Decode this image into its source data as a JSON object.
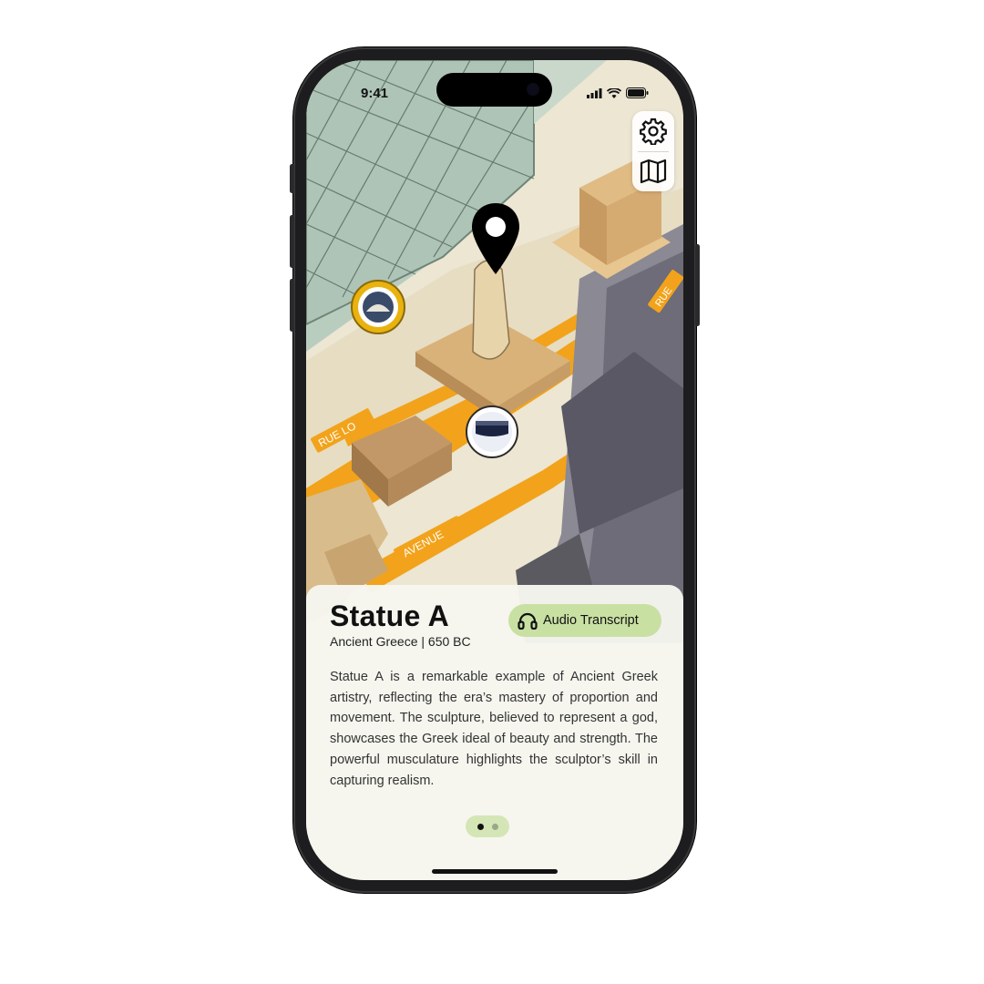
{
  "status_bar": {
    "time": "9:41"
  },
  "map_controls": {
    "settings_icon": "gear-icon",
    "map_icon": "map-icon"
  },
  "map_labels": [
    "RUE LO",
    "AVENUE",
    "RUE"
  ],
  "exhibit": {
    "title": "Statue A",
    "subtitle": "Ancient Greece | 650 BC",
    "audio_button_label": "Audio Transcript",
    "audio_icon": "headphones-icon",
    "description": "Statue A is a remarkable example of Ancient Greek artistry, reflecting the era’s mastery of proportion and movement. The sculpture, believed to represent a god, showcases the Greek ideal of beauty and strength. The powerful musculature highlights the sculptor’s skill in capturing realism."
  },
  "pager": {
    "total": 2,
    "active": 1
  },
  "colors": {
    "accent_green": "#c9e0a3",
    "path_orange": "#f2a31b",
    "pin": "#000000"
  }
}
